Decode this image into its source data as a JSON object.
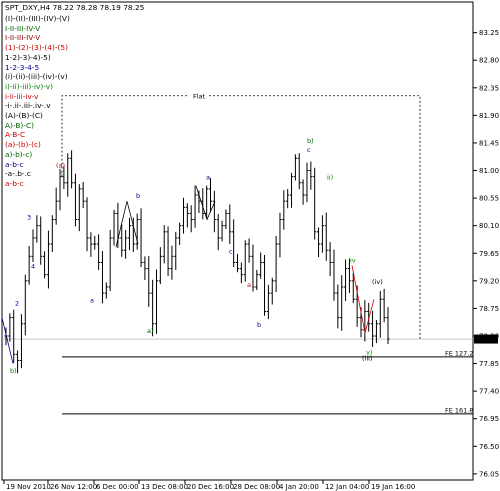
{
  "chart_data": {
    "type": "candlestick",
    "title": "SPT_DXY,H4",
    "ohlc": {
      "open": "78.22",
      "high": "78.28",
      "low": "78.19",
      "close": "78.25"
    },
    "current_price": "78.25",
    "ylim": [
      75.95,
      83.75
    ],
    "y_ticks": [
      "83.25",
      "82.80",
      "82.35",
      "81.90",
      "81.45",
      "81.00",
      "80.55",
      "80.10",
      "79.65",
      "79.20",
      "78.75",
      "78.30",
      "77.85",
      "77.40",
      "76.95",
      "76.50",
      "76.05"
    ],
    "y_values": [
      83.25,
      82.8,
      82.35,
      81.9,
      81.45,
      81.0,
      80.55,
      80.1,
      79.65,
      79.2,
      78.75,
      78.3,
      77.85,
      77.4,
      76.95,
      76.5,
      76.05
    ],
    "x_ticks": [
      "19 Nov 2010",
      "26 Nov 12:00",
      "6 Dec 00:00",
      "13 Dec 08:00",
      "20 Dec 16:00",
      "28 Dec 08:00",
      "4 Jan 20:00",
      "12 Jan 04:00",
      "19 Jan 16:00"
    ],
    "legend": [
      {
        "text": "(I)-(II)-(III)-(IV)-(V)",
        "color": "#000000"
      },
      {
        "text": "I-II-III-IV-V",
        "color": "#006400"
      },
      {
        "text": "I-II-III-IV-V",
        "color": "#8b0000"
      },
      {
        "text": "(1)-(2)-(3)-(4)-(5)",
        "color": "#cc0000"
      },
      {
        "text": "1-2)-3)-4)-5)",
        "color": "#000000"
      },
      {
        "text": "1-2-3-4-5",
        "color": "#00008b"
      },
      {
        "text": "(i)-(ii)-(iii)-(iv)-(v)",
        "color": "#000000"
      },
      {
        "text": "i)-ii)-iii)-iv)-v)",
        "color": "#008000"
      },
      {
        "text": "i-ii-iii-iv-v",
        "color": "#cc0000"
      },
      {
        "text": "-i-.ii-.iii-.iv-.v",
        "color": "#000000"
      },
      {
        "text": "(A)-(B)-(C)",
        "color": "#000000"
      },
      {
        "text": "A)-B)-C)",
        "color": "#006400"
      },
      {
        "text": "A-B-C",
        "color": "#cc0000"
      },
      {
        "text": "(a)-(b)-(c)",
        "color": "#cc0000"
      },
      {
        "text": "a)-b)-c)",
        "color": "#006400"
      },
      {
        "text": "a-b-c",
        "color": "#00008b"
      },
      {
        "text": "-a-.b-.c",
        "color": "#000000"
      },
      {
        "text": "a-b-c",
        "color": "#cc0000"
      }
    ],
    "closes": [
      78.3,
      78.6,
      78.0,
      77.9,
      78.5,
      79.2,
      79.6,
      79.9,
      80.1,
      79.6,
      79.3,
      79.8,
      80.2,
      80.5,
      80.9,
      80.8,
      81.2,
      80.8,
      80.2,
      80.7,
      80.5,
      79.9,
      79.8,
      79.8,
      79.5,
      79.0,
      79.1,
      79.9,
      80.3,
      79.9,
      79.7,
      79.9,
      80.1,
      79.8,
      80.2,
      79.5,
      79.4,
      79.0,
      78.5,
      79.2,
      79.6,
      80.0,
      79.4,
      79.6,
      79.9,
      80.1,
      80.4,
      80.3,
      80.2,
      80.6,
      80.5,
      80.3,
      80.7,
      80.5,
      80.2,
      79.9,
      80.1,
      80.3,
      80.0,
      79.5,
      79.4,
      79.3,
      79.8,
      79.6,
      79.1,
      79.3,
      79.5,
      78.7,
      79.0,
      79.2,
      79.8,
      80.2,
      80.5,
      80.6,
      80.9,
      81.2,
      80.8,
      80.6,
      81.0,
      80.9,
      80.0,
      79.8,
      80.1,
      79.7,
      79.5,
      79.0,
      78.6,
      79.1,
      79.4,
      79.2,
      78.9,
      78.6,
      78.4,
      78.7,
      78.5,
      78.3,
      78.5,
      78.9,
      78.6,
      78.25
    ],
    "annotations": {
      "flat_label": "Flat",
      "fe1_label": "FE 127.2",
      "fe2_label": "FE 161.8"
    }
  }
}
